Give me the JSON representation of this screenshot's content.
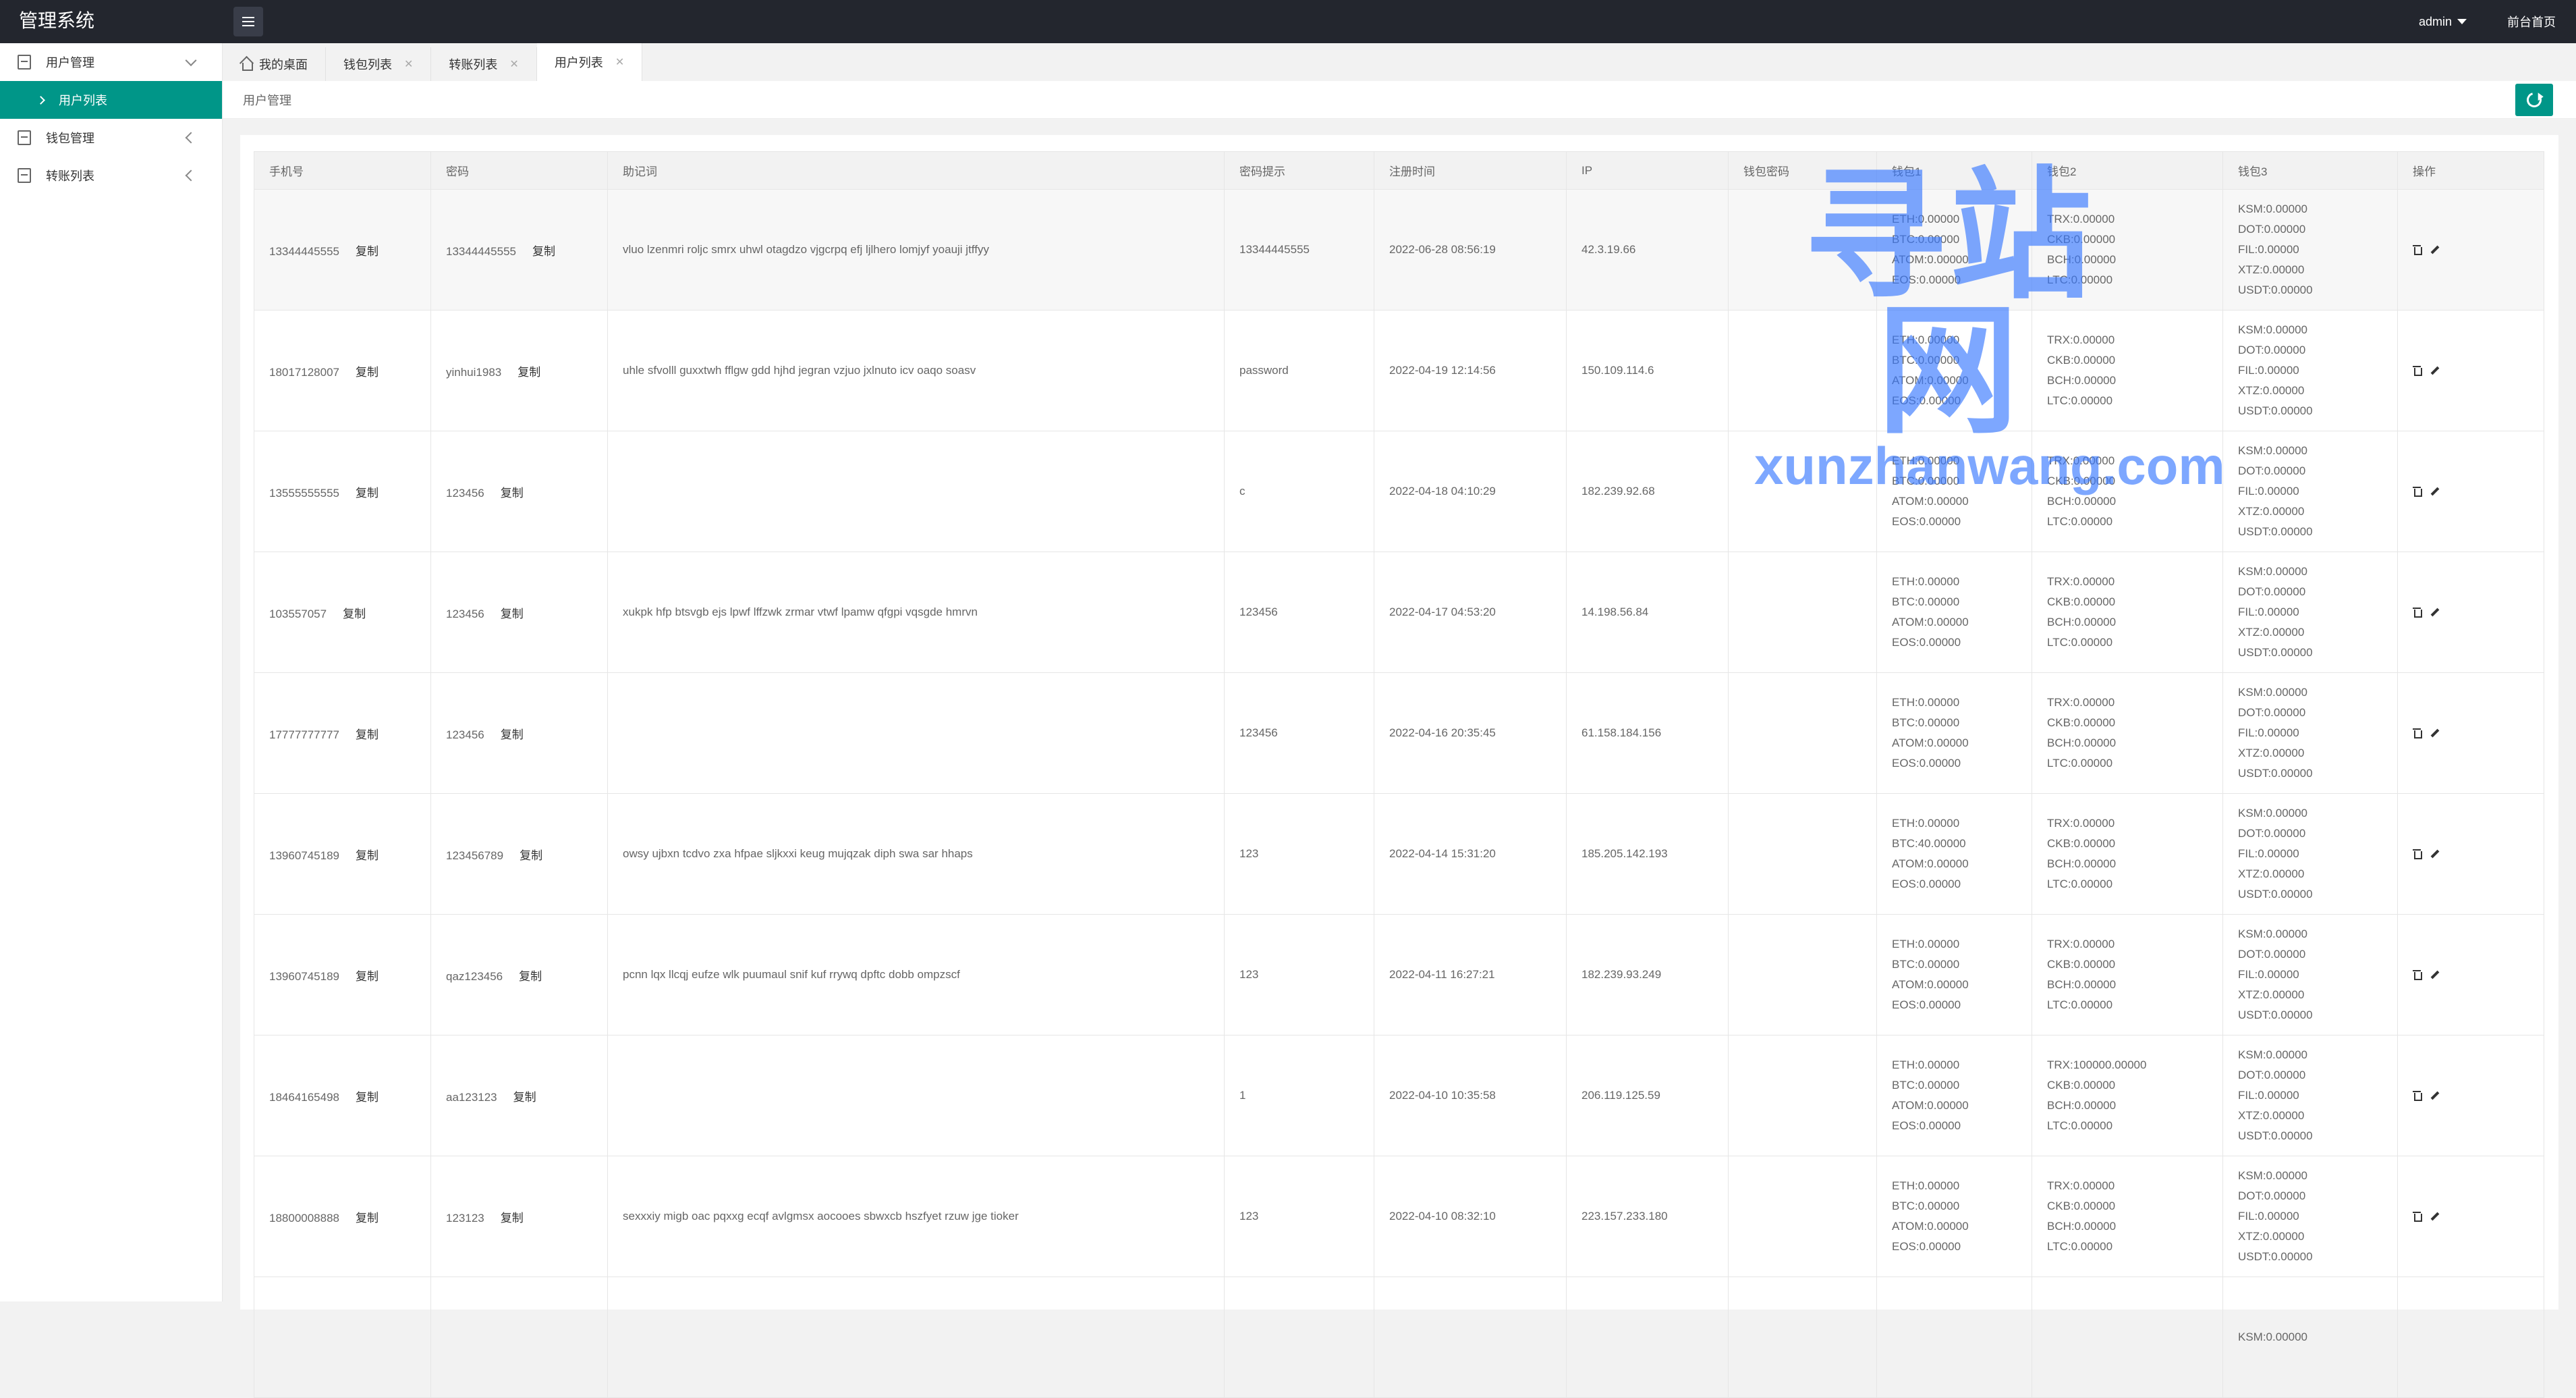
{
  "app": {
    "title": "管理系统",
    "user": "admin",
    "front_page": "前台首页"
  },
  "sidebar": {
    "items": [
      {
        "label": "用户管理",
        "icon": "document-icon",
        "expanded": true
      },
      {
        "label": "钱包管理",
        "icon": "document-icon"
      },
      {
        "label": "转账列表",
        "icon": "document-icon"
      }
    ],
    "sub_items": [
      {
        "label": "用户列表",
        "active": true
      }
    ]
  },
  "tabs": [
    {
      "label": "我的桌面",
      "icon": "home-icon"
    },
    {
      "label": "钱包列表"
    },
    {
      "label": "转账列表"
    },
    {
      "label": "用户列表",
      "active": true
    }
  ],
  "breadcrumb": "用户管理",
  "table": {
    "columns": [
      "手机号",
      "密码",
      "助记词",
      "密码提示",
      "注册时间",
      "IP",
      "钱包密码",
      "钱包1",
      "钱包2",
      "钱包3",
      "操作"
    ],
    "copy_label": "复制",
    "rows": [
      {
        "phone": "13344445555",
        "password": "13344445555",
        "mnemonic": "vluo lzenmri roljc smrx uhwl otagdzo vjgcrpq efj ljlhero lomjyf yoauji jtffyy",
        "hint": "13344445555",
        "reg_time": "2022-06-28 08:56:19",
        "ip": "42.3.19.66",
        "wallet_pwd": "",
        "w1": [
          "ETH:0.00000",
          "BTC:0.00000",
          "ATOM:0.00000",
          "EOS:0.00000"
        ],
        "w2": [
          "TRX:0.00000",
          "CKB:0.00000",
          "BCH:0.00000",
          "LTC:0.00000"
        ],
        "w3": [
          "KSM:0.00000",
          "DOT:0.00000",
          "FIL:0.00000",
          "XTZ:0.00000",
          "USDT:0.00000"
        ]
      },
      {
        "phone": "18017128007",
        "password": "yinhui1983",
        "mnemonic": "uhle sfvolll guxxtwh fflgw gdd hjhd jegran vzjuo jxlnuto icv oaqo soasv",
        "hint": "password",
        "reg_time": "2022-04-19 12:14:56",
        "ip": "150.109.114.6",
        "wallet_pwd": "",
        "w1": [
          "ETH:0.00000",
          "BTC:0.00000",
          "ATOM:0.00000",
          "EOS:0.00000"
        ],
        "w2": [
          "TRX:0.00000",
          "CKB:0.00000",
          "BCH:0.00000",
          "LTC:0.00000"
        ],
        "w3": [
          "KSM:0.00000",
          "DOT:0.00000",
          "FIL:0.00000",
          "XTZ:0.00000",
          "USDT:0.00000"
        ]
      },
      {
        "phone": "13555555555",
        "password": "123456",
        "mnemonic": "",
        "hint": "c",
        "reg_time": "2022-04-18 04:10:29",
        "ip": "182.239.92.68",
        "wallet_pwd": "",
        "w1": [
          "ETH:0.00000",
          "BTC:0.00000",
          "ATOM:0.00000",
          "EOS:0.00000"
        ],
        "w2": [
          "TRX:0.00000",
          "CKB:0.00000",
          "BCH:0.00000",
          "LTC:0.00000"
        ],
        "w3": [
          "KSM:0.00000",
          "DOT:0.00000",
          "FIL:0.00000",
          "XTZ:0.00000",
          "USDT:0.00000"
        ]
      },
      {
        "phone": "103557057",
        "password": "123456",
        "mnemonic": "xukpk hfp btsvgb ejs lpwf lffzwk zrmar vtwf lpamw qfgpi vqsgde hmrvn",
        "hint": "123456",
        "reg_time": "2022-04-17 04:53:20",
        "ip": "14.198.56.84",
        "wallet_pwd": "",
        "w1": [
          "ETH:0.00000",
          "BTC:0.00000",
          "ATOM:0.00000",
          "EOS:0.00000"
        ],
        "w2": [
          "TRX:0.00000",
          "CKB:0.00000",
          "BCH:0.00000",
          "LTC:0.00000"
        ],
        "w3": [
          "KSM:0.00000",
          "DOT:0.00000",
          "FIL:0.00000",
          "XTZ:0.00000",
          "USDT:0.00000"
        ]
      },
      {
        "phone": "17777777777",
        "password": "123456",
        "mnemonic": "",
        "hint": "123456",
        "reg_time": "2022-04-16 20:35:45",
        "ip": "61.158.184.156",
        "wallet_pwd": "",
        "w1": [
          "ETH:0.00000",
          "BTC:0.00000",
          "ATOM:0.00000",
          "EOS:0.00000"
        ],
        "w2": [
          "TRX:0.00000",
          "CKB:0.00000",
          "BCH:0.00000",
          "LTC:0.00000"
        ],
        "w3": [
          "KSM:0.00000",
          "DOT:0.00000",
          "FIL:0.00000",
          "XTZ:0.00000",
          "USDT:0.00000"
        ]
      },
      {
        "phone": "13960745189",
        "password": "123456789",
        "mnemonic": "owsy ujbxn tcdvo zxa hfpae sljkxxi keug mujqzak diph swa sar hhaps",
        "hint": "123",
        "reg_time": "2022-04-14 15:31:20",
        "ip": "185.205.142.193",
        "wallet_pwd": "",
        "w1": [
          "ETH:0.00000",
          "BTC:40.00000",
          "ATOM:0.00000",
          "EOS:0.00000"
        ],
        "w2": [
          "TRX:0.00000",
          "CKB:0.00000",
          "BCH:0.00000",
          "LTC:0.00000"
        ],
        "w3": [
          "KSM:0.00000",
          "DOT:0.00000",
          "FIL:0.00000",
          "XTZ:0.00000",
          "USDT:0.00000"
        ]
      },
      {
        "phone": "13960745189",
        "password": "qaz123456",
        "mnemonic": "pcnn lqx llcqj eufze wlk puumaul snif kuf rrywq dpftc dobb ompzscf",
        "hint": "123",
        "reg_time": "2022-04-11 16:27:21",
        "ip": "182.239.93.249",
        "wallet_pwd": "",
        "w1": [
          "ETH:0.00000",
          "BTC:0.00000",
          "ATOM:0.00000",
          "EOS:0.00000"
        ],
        "w2": [
          "TRX:0.00000",
          "CKB:0.00000",
          "BCH:0.00000",
          "LTC:0.00000"
        ],
        "w3": [
          "KSM:0.00000",
          "DOT:0.00000",
          "FIL:0.00000",
          "XTZ:0.00000",
          "USDT:0.00000"
        ]
      },
      {
        "phone": "18464165498",
        "password": "aa123123",
        "mnemonic": "",
        "hint": "1",
        "reg_time": "2022-04-10 10:35:58",
        "ip": "206.119.125.59",
        "wallet_pwd": "",
        "w1": [
          "ETH:0.00000",
          "BTC:0.00000",
          "ATOM:0.00000",
          "EOS:0.00000"
        ],
        "w2": [
          "TRX:100000.00000",
          "CKB:0.00000",
          "BCH:0.00000",
          "LTC:0.00000"
        ],
        "w3": [
          "KSM:0.00000",
          "DOT:0.00000",
          "FIL:0.00000",
          "XTZ:0.00000",
          "USDT:0.00000"
        ]
      },
      {
        "phone": "18800008888",
        "password": "123123",
        "mnemonic": "sexxxiy migb oac pqxxg ecqf avlgmsx aocooes sbwxcb hszfyet rzuw jge tioker",
        "hint": "123",
        "reg_time": "2022-04-10 08:32:10",
        "ip": "223.157.233.180",
        "wallet_pwd": "",
        "w1": [
          "ETH:0.00000",
          "BTC:0.00000",
          "ATOM:0.00000",
          "EOS:0.00000"
        ],
        "w2": [
          "TRX:0.00000",
          "CKB:0.00000",
          "BCH:0.00000",
          "LTC:0.00000"
        ],
        "w3": [
          "KSM:0.00000",
          "DOT:0.00000",
          "FIL:0.00000",
          "XTZ:0.00000",
          "USDT:0.00000"
        ]
      },
      {
        "phone": "",
        "password": "",
        "mnemonic": "",
        "hint": "",
        "reg_time": "",
        "ip": "",
        "wallet_pwd": "",
        "w1": [],
        "w2": [],
        "w3": [
          "KSM:0.00000"
        ]
      }
    ]
  },
  "watermark": {
    "big": "寻站网",
    "small": "xunzhanwang.com"
  },
  "colors": {
    "header_bg": "#23262e",
    "accent": "#009688",
    "watermark": "#3878ff"
  }
}
